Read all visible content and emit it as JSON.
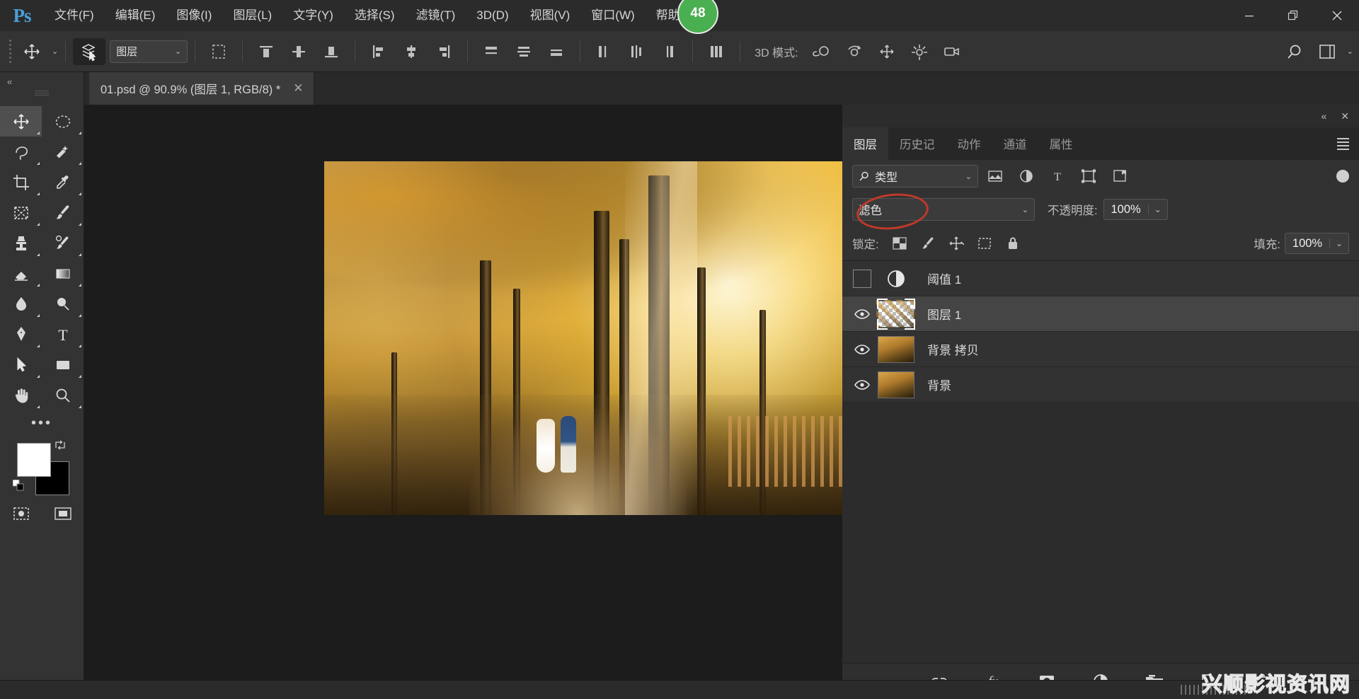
{
  "app": {
    "logo": "Ps",
    "menu": [
      {
        "label": "文件(F)"
      },
      {
        "label": "编辑(E)"
      },
      {
        "label": "图像(I)"
      },
      {
        "label": "图层(L)"
      },
      {
        "label": "文字(Y)"
      },
      {
        "label": "选择(S)"
      },
      {
        "label": "滤镜(T)"
      },
      {
        "label": "3D(D)"
      },
      {
        "label": "视图(V)"
      },
      {
        "label": "窗口(W)"
      },
      {
        "label": "帮助(H)"
      }
    ],
    "notification_badge": "48",
    "window_controls": {
      "minimize": "—",
      "restore": "❐",
      "close": "✕"
    }
  },
  "options_bar": {
    "move_tool": "move-tool",
    "auto_select_label": "图层",
    "mode_3d_label": "3D 模式:",
    "search_icon": "search-icon",
    "workspace_icon": "workspace-icon"
  },
  "document": {
    "tab_title": "01.psd @ 90.9% (图层 1, RGB/8) *",
    "close_glyph": "✕"
  },
  "toolbar": {
    "collapse_glyph": "«",
    "tools": [
      {
        "name": "move-tool",
        "selected": true
      },
      {
        "name": "elliptical-marquee-tool",
        "selected": false
      },
      {
        "name": "lasso-tool",
        "selected": false
      },
      {
        "name": "quick-selection-tool",
        "selected": false
      },
      {
        "name": "crop-tool",
        "selected": false
      },
      {
        "name": "eyedropper-tool",
        "selected": false
      },
      {
        "name": "frame-tool",
        "selected": false
      },
      {
        "name": "brush-tool",
        "selected": false
      },
      {
        "name": "clone-stamp-tool",
        "selected": false
      },
      {
        "name": "history-brush-tool",
        "selected": false
      },
      {
        "name": "eraser-tool",
        "selected": false
      },
      {
        "name": "gradient-tool",
        "selected": false
      },
      {
        "name": "blur-tool",
        "selected": false
      },
      {
        "name": "dodge-tool",
        "selected": false
      },
      {
        "name": "pen-tool",
        "selected": false
      },
      {
        "name": "type-tool",
        "selected": false
      },
      {
        "name": "path-selection-tool",
        "selected": false
      },
      {
        "name": "rectangle-tool",
        "selected": false
      },
      {
        "name": "hand-tool",
        "selected": false
      },
      {
        "name": "zoom-tool",
        "selected": false
      }
    ],
    "more_tools_glyph": "•••",
    "foreground_color": "#ffffff",
    "background_color": "#000000"
  },
  "panel": {
    "collapse_glyph": "«",
    "close_glyph": "✕",
    "tabs": [
      {
        "label": "图层",
        "active": true
      },
      {
        "label": "历史记",
        "active": false
      },
      {
        "label": "动作",
        "active": false
      },
      {
        "label": "通道",
        "active": false
      },
      {
        "label": "属性",
        "active": false
      }
    ],
    "filter": {
      "type_label": "类型",
      "search_icon": "search-icon",
      "icons": [
        "pixel-filter-icon",
        "adjustment-filter-icon",
        "type-filter-icon",
        "shape-filter-icon",
        "smartobject-filter-icon"
      ]
    },
    "blend": {
      "mode": "滤色",
      "opacity_label": "不透明度:",
      "opacity_value": "100%",
      "highlight_color": "#c0392b"
    },
    "lock": {
      "label": "锁定:",
      "fill_label": "填充:",
      "fill_value": "100%",
      "icons": [
        "lock-transparency-icon",
        "lock-image-icon",
        "lock-position-icon",
        "lock-artboard-icon",
        "lock-all-icon"
      ]
    },
    "layers": [
      {
        "name": "阈值 1",
        "visible": false,
        "selected": false,
        "kind": "adjustment"
      },
      {
        "name": "图层 1",
        "visible": true,
        "selected": true,
        "kind": "pixel-transparent"
      },
      {
        "name": "背景 拷贝",
        "visible": true,
        "selected": false,
        "kind": "pixel"
      },
      {
        "name": "背景",
        "visible": true,
        "selected": false,
        "kind": "pixel"
      }
    ],
    "footer_buttons": [
      {
        "name": "link-layers-button",
        "glyph": "link"
      },
      {
        "name": "layer-style-button",
        "glyph": "fx"
      },
      {
        "name": "add-mask-button",
        "glyph": "mask"
      },
      {
        "name": "new-adjustment-button",
        "glyph": "adjust"
      },
      {
        "name": "new-group-button",
        "glyph": "folder"
      },
      {
        "name": "new-layer-button",
        "glyph": "new"
      },
      {
        "name": "delete-layer-button",
        "glyph": "trash"
      }
    ]
  },
  "watermark": {
    "text": "兴顺影视资讯网"
  }
}
